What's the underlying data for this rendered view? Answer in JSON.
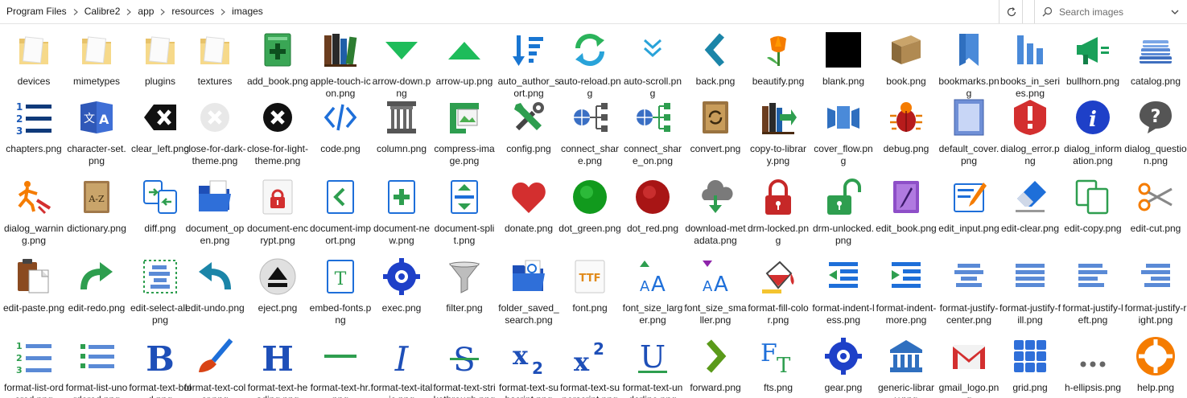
{
  "address_bar": {
    "breadcrumb": [
      "Program Files",
      "Calibre2",
      "app",
      "resources",
      "images"
    ],
    "search_placeholder": "Search images"
  },
  "files": [
    {
      "name": "devices",
      "icon": "folder-icon"
    },
    {
      "name": "mimetypes",
      "icon": "folder-icon"
    },
    {
      "name": "plugins",
      "icon": "folder-icon"
    },
    {
      "name": "textures",
      "icon": "folder-icon"
    },
    {
      "name": "add_book.png",
      "icon": "add-book-icon"
    },
    {
      "name": "apple-touch-icon.png",
      "icon": "books-shelf-icon"
    },
    {
      "name": "arrow-down.png",
      "icon": "arrow-down-icon"
    },
    {
      "name": "arrow-up.png",
      "icon": "arrow-up-icon"
    },
    {
      "name": "auto_author_sort.png",
      "icon": "sort-icon"
    },
    {
      "name": "auto-reload.png",
      "icon": "reload-icon"
    },
    {
      "name": "auto-scroll.png",
      "icon": "auto-scroll-icon"
    },
    {
      "name": "back.png",
      "icon": "back-icon"
    },
    {
      "name": "beautify.png",
      "icon": "tulip-icon"
    },
    {
      "name": "blank.png",
      "icon": "blank-icon"
    },
    {
      "name": "book.png",
      "icon": "book-icon"
    },
    {
      "name": "bookmarks.png",
      "icon": "bookmark-icon"
    },
    {
      "name": "books_in_series.png",
      "icon": "series-icon"
    },
    {
      "name": "bullhorn.png",
      "icon": "bullhorn-icon"
    },
    {
      "name": "catalog.png",
      "icon": "catalog-icon"
    },
    {
      "name": "chapters.png",
      "icon": "chapters-icon"
    },
    {
      "name": "character-set.png",
      "icon": "character-set-icon"
    },
    {
      "name": "clear_left.png",
      "icon": "clear-left-icon"
    },
    {
      "name": "close-for-dark-theme.png",
      "icon": "close-dark-theme-icon"
    },
    {
      "name": "close-for-light-theme.png",
      "icon": "close-light-theme-icon"
    },
    {
      "name": "code.png",
      "icon": "code-icon"
    },
    {
      "name": "column.png",
      "icon": "column-icon"
    },
    {
      "name": "compress-image.png",
      "icon": "compress-image-icon"
    },
    {
      "name": "config.png",
      "icon": "config-icon"
    },
    {
      "name": "connect_share.png",
      "icon": "connect-share-icon"
    },
    {
      "name": "connect_share_on.png",
      "icon": "connect-share-on-icon"
    },
    {
      "name": "convert.png",
      "icon": "convert-icon"
    },
    {
      "name": "copy-to-library.png",
      "icon": "copy-to-library-icon"
    },
    {
      "name": "cover_flow.png",
      "icon": "cover-flow-icon"
    },
    {
      "name": "debug.png",
      "icon": "bug-icon"
    },
    {
      "name": "default_cover.png",
      "icon": "default-cover-icon"
    },
    {
      "name": "dialog_error.png",
      "icon": "error-icon"
    },
    {
      "name": "dialog_information.png",
      "icon": "information-icon"
    },
    {
      "name": "dialog_question.png",
      "icon": "question-icon"
    },
    {
      "name": "dialog_warning.png",
      "icon": "warning-icon"
    },
    {
      "name": "dictionary.png",
      "icon": "dictionary-icon"
    },
    {
      "name": "diff.png",
      "icon": "diff-icon"
    },
    {
      "name": "document_open.png",
      "icon": "document-open-icon"
    },
    {
      "name": "document-encrypt.png",
      "icon": "document-encrypt-icon"
    },
    {
      "name": "document-import.png",
      "icon": "document-import-icon"
    },
    {
      "name": "document-new.png",
      "icon": "document-new-icon"
    },
    {
      "name": "document-split.png",
      "icon": "document-split-icon"
    },
    {
      "name": "donate.png",
      "icon": "heart-icon"
    },
    {
      "name": "dot_green.png",
      "icon": "green-dot-icon"
    },
    {
      "name": "dot_red.png",
      "icon": "red-dot-icon"
    },
    {
      "name": "download-metadata.png",
      "icon": "download-cloud-icon"
    },
    {
      "name": "drm-locked.png",
      "icon": "lock-closed-icon"
    },
    {
      "name": "drm-unlocked.png",
      "icon": "lock-open-icon"
    },
    {
      "name": "edit_book.png",
      "icon": "edit-book-icon"
    },
    {
      "name": "edit_input.png",
      "icon": "edit-input-icon"
    },
    {
      "name": "edit-clear.png",
      "icon": "eraser-icon"
    },
    {
      "name": "edit-copy.png",
      "icon": "copy-icon"
    },
    {
      "name": "edit-cut.png",
      "icon": "scissors-icon"
    },
    {
      "name": "edit-paste.png",
      "icon": "paste-icon"
    },
    {
      "name": "edit-redo.png",
      "icon": "redo-icon"
    },
    {
      "name": "edit-select-all.png",
      "icon": "select-all-icon"
    },
    {
      "name": "edit-undo.png",
      "icon": "undo-icon"
    },
    {
      "name": "eject.png",
      "icon": "eject-icon"
    },
    {
      "name": "embed-fonts.png",
      "icon": "embed-fonts-icon"
    },
    {
      "name": "exec.png",
      "icon": "gear-icon"
    },
    {
      "name": "filter.png",
      "icon": "funnel-icon"
    },
    {
      "name": "folder_saved_search.png",
      "icon": "folder-search-icon"
    },
    {
      "name": "font.png",
      "icon": "ttf-font-icon"
    },
    {
      "name": "font_size_larger.png",
      "icon": "font-larger-icon"
    },
    {
      "name": "font_size_smaller.png",
      "icon": "font-smaller-icon"
    },
    {
      "name": "format-fill-color.png",
      "icon": "paint-bucket-icon"
    },
    {
      "name": "format-indent-less.png",
      "icon": "indent-less-icon"
    },
    {
      "name": "format-indent-more.png",
      "icon": "indent-more-icon"
    },
    {
      "name": "format-justify-center.png",
      "icon": "justify-center-icon"
    },
    {
      "name": "format-justify-fill.png",
      "icon": "justify-fill-icon"
    },
    {
      "name": "format-justify-left.png",
      "icon": "justify-left-icon"
    },
    {
      "name": "format-justify-right.png",
      "icon": "justify-right-icon"
    },
    {
      "name": "format-list-ordered.png",
      "icon": "ordered-list-icon"
    },
    {
      "name": "format-list-unordered.png",
      "icon": "unordered-list-icon"
    },
    {
      "name": "format-text-bold.png",
      "icon": "bold-icon"
    },
    {
      "name": "format-text-color.png",
      "icon": "brush-icon"
    },
    {
      "name": "format-text-heading.png",
      "icon": "heading-icon"
    },
    {
      "name": "format-text-hr.png",
      "icon": "horizontal-rule-icon"
    },
    {
      "name": "format-text-italic.png",
      "icon": "italic-icon"
    },
    {
      "name": "format-text-strikethrough.png",
      "icon": "strikethrough-icon"
    },
    {
      "name": "format-text-subscript.png",
      "icon": "subscript-icon"
    },
    {
      "name": "format-text-superscript.png",
      "icon": "superscript-icon"
    },
    {
      "name": "format-text-underline.png",
      "icon": "underline-icon"
    },
    {
      "name": "forward.png",
      "icon": "forward-icon"
    },
    {
      "name": "fts.png",
      "icon": "fts-icon"
    },
    {
      "name": "gear.png",
      "icon": "gear-icon"
    },
    {
      "name": "generic-library.png",
      "icon": "library-icon"
    },
    {
      "name": "gmail_logo.png",
      "icon": "gmail-icon"
    },
    {
      "name": "grid.png",
      "icon": "grid-icon"
    },
    {
      "name": "h-ellipsis.png",
      "icon": "ellipsis-icon"
    },
    {
      "name": "help.png",
      "icon": "lifebuoy-icon"
    }
  ]
}
